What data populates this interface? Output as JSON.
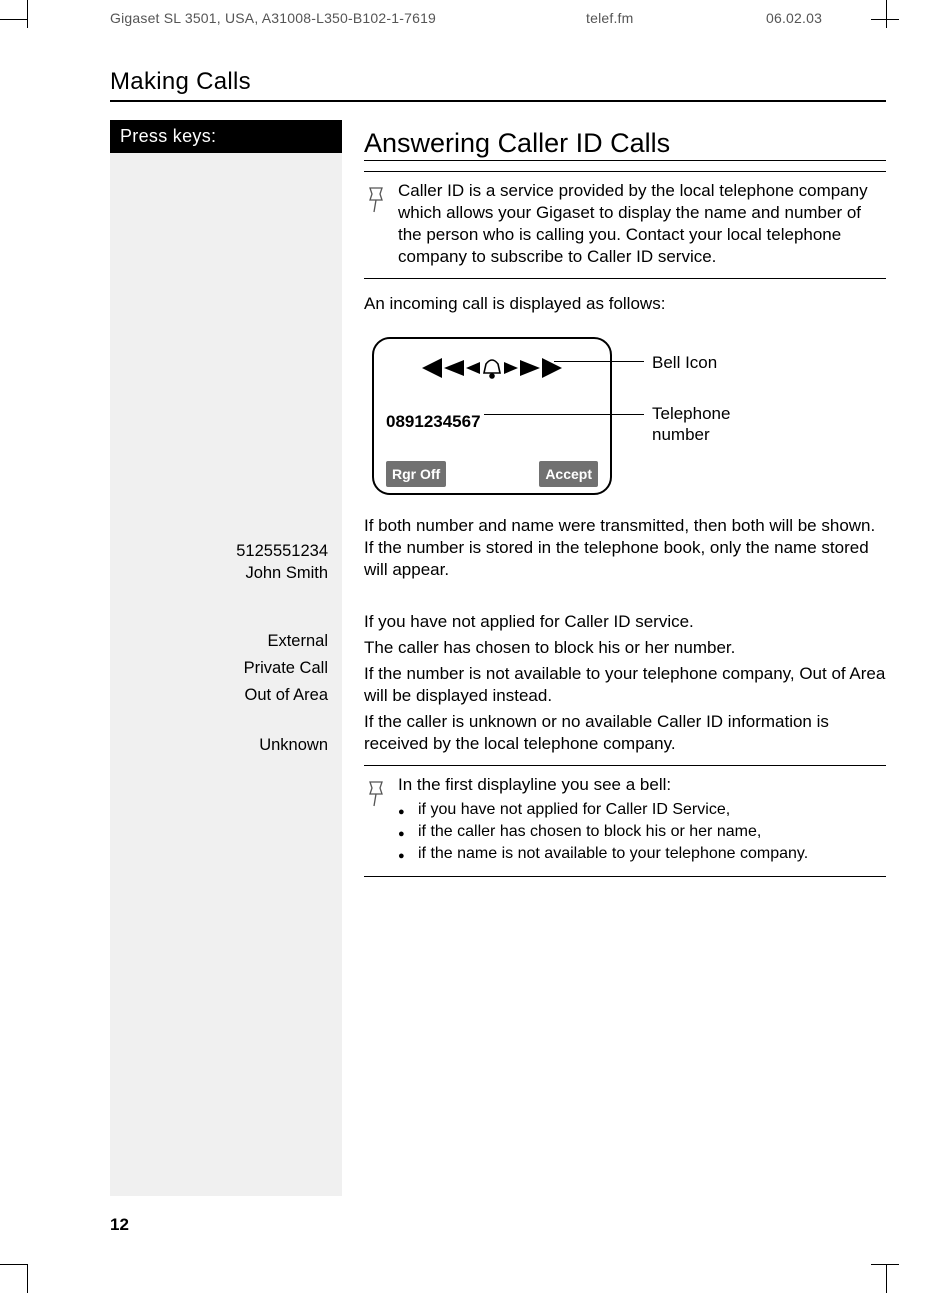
{
  "runhead": {
    "left": "Gigaset SL 3501, USA, A31008-L350-B102-1-7619",
    "center": "telef.fm",
    "right": "06.02.03"
  },
  "section_title": "Making Calls",
  "press_keys_label": "Press keys:",
  "heading": "Answering Caller ID Calls",
  "note1": "Caller ID is a service provided by the local telephone company which allows your Gigaset to display the name and number of the person who is calling you. Contact your local telephone company to subscribe to Caller ID service.",
  "intro": "An incoming call is displayed as follows:",
  "display": {
    "number": "0891234567",
    "softkey_left": "Rgr Off",
    "softkey_right": "Accept",
    "callout_bell": "Bell Icon",
    "callout_number_l1": "Telephone",
    "callout_number_l2": "number"
  },
  "para_both": "If both number and name were transmitted, then both will be shown. If the number is stored in the telephone book, only the name stored will appear.",
  "side_example_number": "5125551234",
  "side_example_name": "John Smith",
  "rows": {
    "external": {
      "label": "External",
      "desc": "If you have not applied for Caller ID service."
    },
    "private": {
      "label": "Private Call",
      "desc": "The caller has chosen to block his or her number."
    },
    "outofarea": {
      "label": "Out of Area",
      "desc": "If the number is not available to your telephone company, Out of Area will be displayed instead."
    },
    "unknown": {
      "label": "Unknown",
      "desc": "If the caller is unknown or no available Caller ID information is received by the local telephone company."
    }
  },
  "note2_lead": "In the first displayline you see a bell:",
  "note2_bullets": [
    "if you have not applied for Caller ID Service,",
    "if the caller has chosen to block his or her name,",
    "if the name is not available to your telephone company."
  ],
  "page_number": "12"
}
